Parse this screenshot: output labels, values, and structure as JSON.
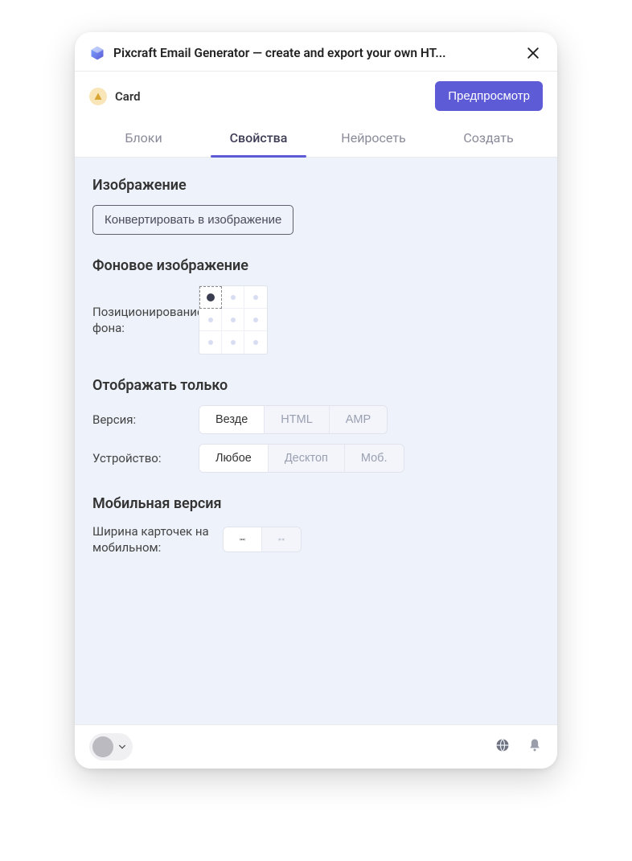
{
  "header": {
    "title": "Pixcraft Email Generator — create and export your own HT..."
  },
  "subheader": {
    "card_label": "Card",
    "preview_button": "Предпросмотр"
  },
  "tabs": {
    "blocks": "Блоки",
    "properties": "Свойства",
    "ai": "Нейросеть",
    "create": "Создать"
  },
  "sections": {
    "image": {
      "title": "Изображение",
      "convert_button": "Конвертировать в изображение"
    },
    "background_image": {
      "title": "Фоновое изображение",
      "position_label": "Позиционирование фона:"
    },
    "show_only": {
      "title": "Отображать только",
      "version_label": "Версия:",
      "version_options": [
        "Везде",
        "HTML",
        "AMP"
      ],
      "device_label": "Устройство:",
      "device_options": [
        "Любое",
        "Десктоп",
        "Моб."
      ]
    },
    "mobile": {
      "title": "Мобильная версия",
      "card_width_label": "Ширина карточек на мобильном:"
    }
  }
}
